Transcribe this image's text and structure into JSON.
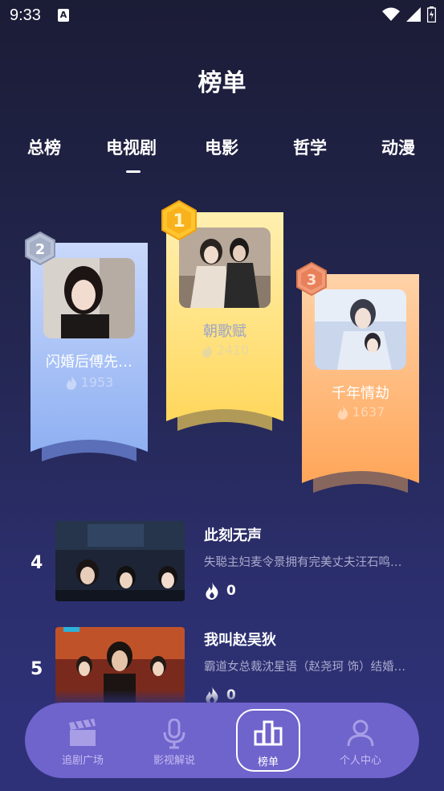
{
  "status": {
    "time": "9:33",
    "notif_icon": "A"
  },
  "page_title": "榜单",
  "tabs": [
    {
      "label": "总榜",
      "active": false
    },
    {
      "label": "电视剧",
      "active": true
    },
    {
      "label": "电影",
      "active": false
    },
    {
      "label": "哲学",
      "active": false
    },
    {
      "label": "动漫",
      "active": false
    }
  ],
  "podium": [
    {
      "rank": "1",
      "title": "朝歌赋",
      "heat": "2410",
      "color": "#ffe27a"
    },
    {
      "rank": "2",
      "title": "闪婚后傅先…",
      "heat": "1953",
      "color": "#a7c0f5"
    },
    {
      "rank": "3",
      "title": "千年情劫",
      "heat": "1637",
      "color": "#ffb26e"
    }
  ],
  "list": [
    {
      "rank": "4",
      "title": "此刻无声",
      "desc": "失聪主妇麦令景拥有完美丈夫汪石鸣…",
      "heat": "0"
    },
    {
      "rank": "5",
      "title": "我叫赵吴狄",
      "desc": "霸道女总裁沈星语（赵尧珂 饰）结婚…",
      "heat": "0"
    }
  ],
  "nav": [
    {
      "label": "追剧广场",
      "icon": "clapperboard-icon",
      "active": false
    },
    {
      "label": "影视解说",
      "icon": "microphone-icon",
      "active": false
    },
    {
      "label": "榜单",
      "icon": "ranking-icon",
      "active": true
    },
    {
      "label": "个人中心",
      "icon": "user-icon",
      "active": false
    }
  ]
}
